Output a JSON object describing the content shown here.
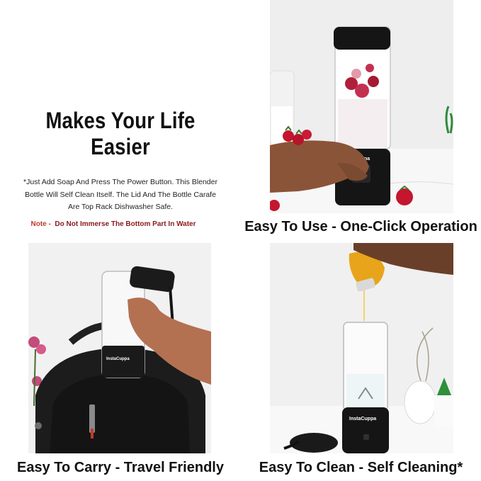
{
  "headline": "Makes Your Life Easier",
  "description_lines": [
    "*Just Add Soap And Press The Power Button. This Blender",
    "Bottle Will Self Clean Itself. The Lid And The Bottle Carafe",
    "Are Top Rack Dishwasher Safe."
  ],
  "note": {
    "label": "Note -",
    "text": "Do Not Immerse The Bottom Part In Water"
  },
  "brand": "InstaCuppa",
  "captions": {
    "top_right": "Easy To Use - One-Click Operation",
    "bottom_left": "Easy To Carry - Travel Friendly",
    "bottom_right": "Easy To Clean - Self Cleaning*"
  },
  "colors": {
    "note_label": "#c0392b",
    "note_text": "#8b1a1a",
    "blender_body": "#151515"
  }
}
